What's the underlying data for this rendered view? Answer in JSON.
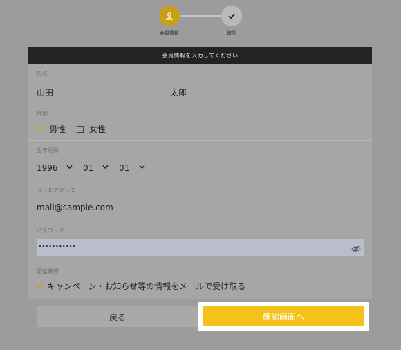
{
  "stepper": {
    "steps": [
      {
        "label": "会員情報",
        "icon": "user-icon",
        "state": "active"
      },
      {
        "label": "確認",
        "icon": "check-icon",
        "state": "inactive"
      }
    ],
    "active_color": "#c99f16"
  },
  "form": {
    "header": "会員情報を入力してください",
    "name": {
      "label": "氏名",
      "last": "山田",
      "first": "太郎"
    },
    "gender": {
      "label": "性別",
      "options": [
        {
          "label": "男性",
          "checked": true
        },
        {
          "label": "女性",
          "checked": false
        }
      ]
    },
    "birth": {
      "label": "生年月日",
      "year": "1996",
      "month": "01",
      "day": "01"
    },
    "email": {
      "label": "メールアドレス",
      "value": "mail@sample.com"
    },
    "password": {
      "label": "パスワード",
      "masked": "•••••••••••"
    },
    "preference": {
      "label": "配信希望",
      "option": "キャンペーン・お知らせ等の情報をメールで受け取る",
      "checked": true
    }
  },
  "buttons": {
    "back": "戻る",
    "confirm": "確認画面へ",
    "confirm_color": "#f4c21b"
  }
}
